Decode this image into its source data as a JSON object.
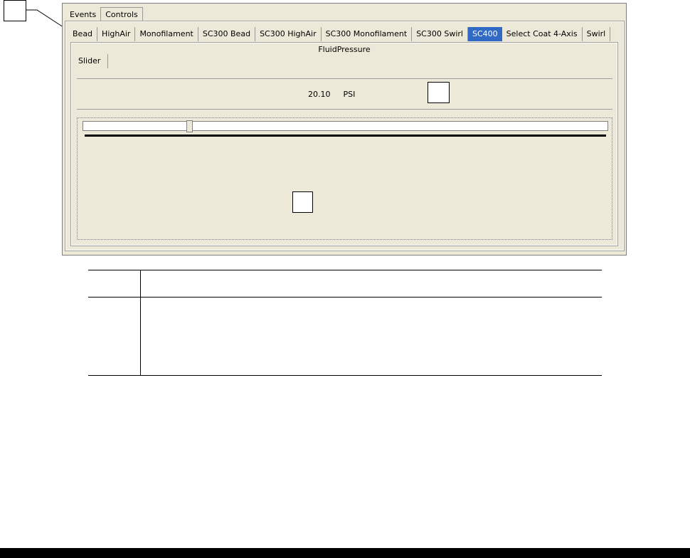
{
  "outer_tabs": [
    "Events",
    "Controls"
  ],
  "device_tabs": [
    "Bead",
    "HighAir",
    "Monofilament",
    "SC300 Bead",
    "SC300 HighAir",
    "SC300 Monofilament",
    "SC300 Swirl",
    "SC400",
    "Select Coat 4-Axis",
    "Swirl"
  ],
  "selected_device_tab": "SC400",
  "group_title": "FluidPressure",
  "sub_tabs": [
    "Slider"
  ],
  "reading": {
    "value": "20.10",
    "unit": "PSI"
  },
  "slider": {
    "level_fraction": 0.2
  },
  "colors": {
    "selected_tab": "#316ac5",
    "panel_bg": "#ece9d8"
  }
}
